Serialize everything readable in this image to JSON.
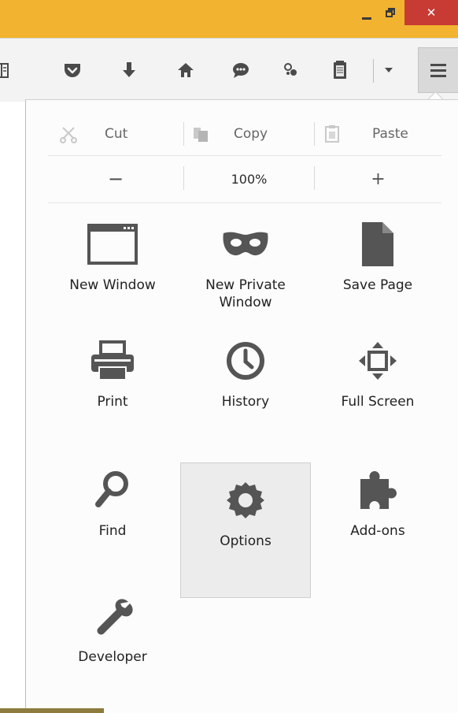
{
  "window": {
    "controls": {
      "minimize_icon": "minimize-icon",
      "maximize_icon": "restore-icon",
      "close_glyph": "✕"
    },
    "colors": {
      "titlebar": "#f2b330",
      "close": "#c73b34"
    }
  },
  "toolbar": {
    "icons": [
      "reader-icon",
      "pocket-icon",
      "download-icon",
      "home-icon",
      "chat-icon",
      "extension-icon",
      "clipboard-icon",
      "dropdown-arrow-icon",
      "hamburger-menu-icon"
    ]
  },
  "menu": {
    "edit": {
      "cut": "Cut",
      "copy": "Copy",
      "paste": "Paste"
    },
    "zoom": {
      "minus": "−",
      "value": "100%",
      "plus": "+"
    },
    "items": [
      {
        "id": "new-window",
        "label": "New Window",
        "icon": "window-icon"
      },
      {
        "id": "new-private-window",
        "label": "New Private\nWindow",
        "icon": "mask-icon"
      },
      {
        "id": "save-page",
        "label": "Save Page",
        "icon": "page-icon"
      },
      {
        "id": "print",
        "label": "Print",
        "icon": "printer-icon"
      },
      {
        "id": "history",
        "label": "History",
        "icon": "clock-icon"
      },
      {
        "id": "full-screen",
        "label": "Full Screen",
        "icon": "fullscreen-arrows-icon"
      },
      {
        "id": "find",
        "label": "Find",
        "icon": "magnifier-icon"
      },
      {
        "id": "options",
        "label": "Options",
        "icon": "gear-icon",
        "selected": true
      },
      {
        "id": "add-ons",
        "label": "Add-ons",
        "icon": "puzzle-icon"
      },
      {
        "id": "developer",
        "label": "Developer",
        "icon": "wrench-icon"
      }
    ]
  }
}
